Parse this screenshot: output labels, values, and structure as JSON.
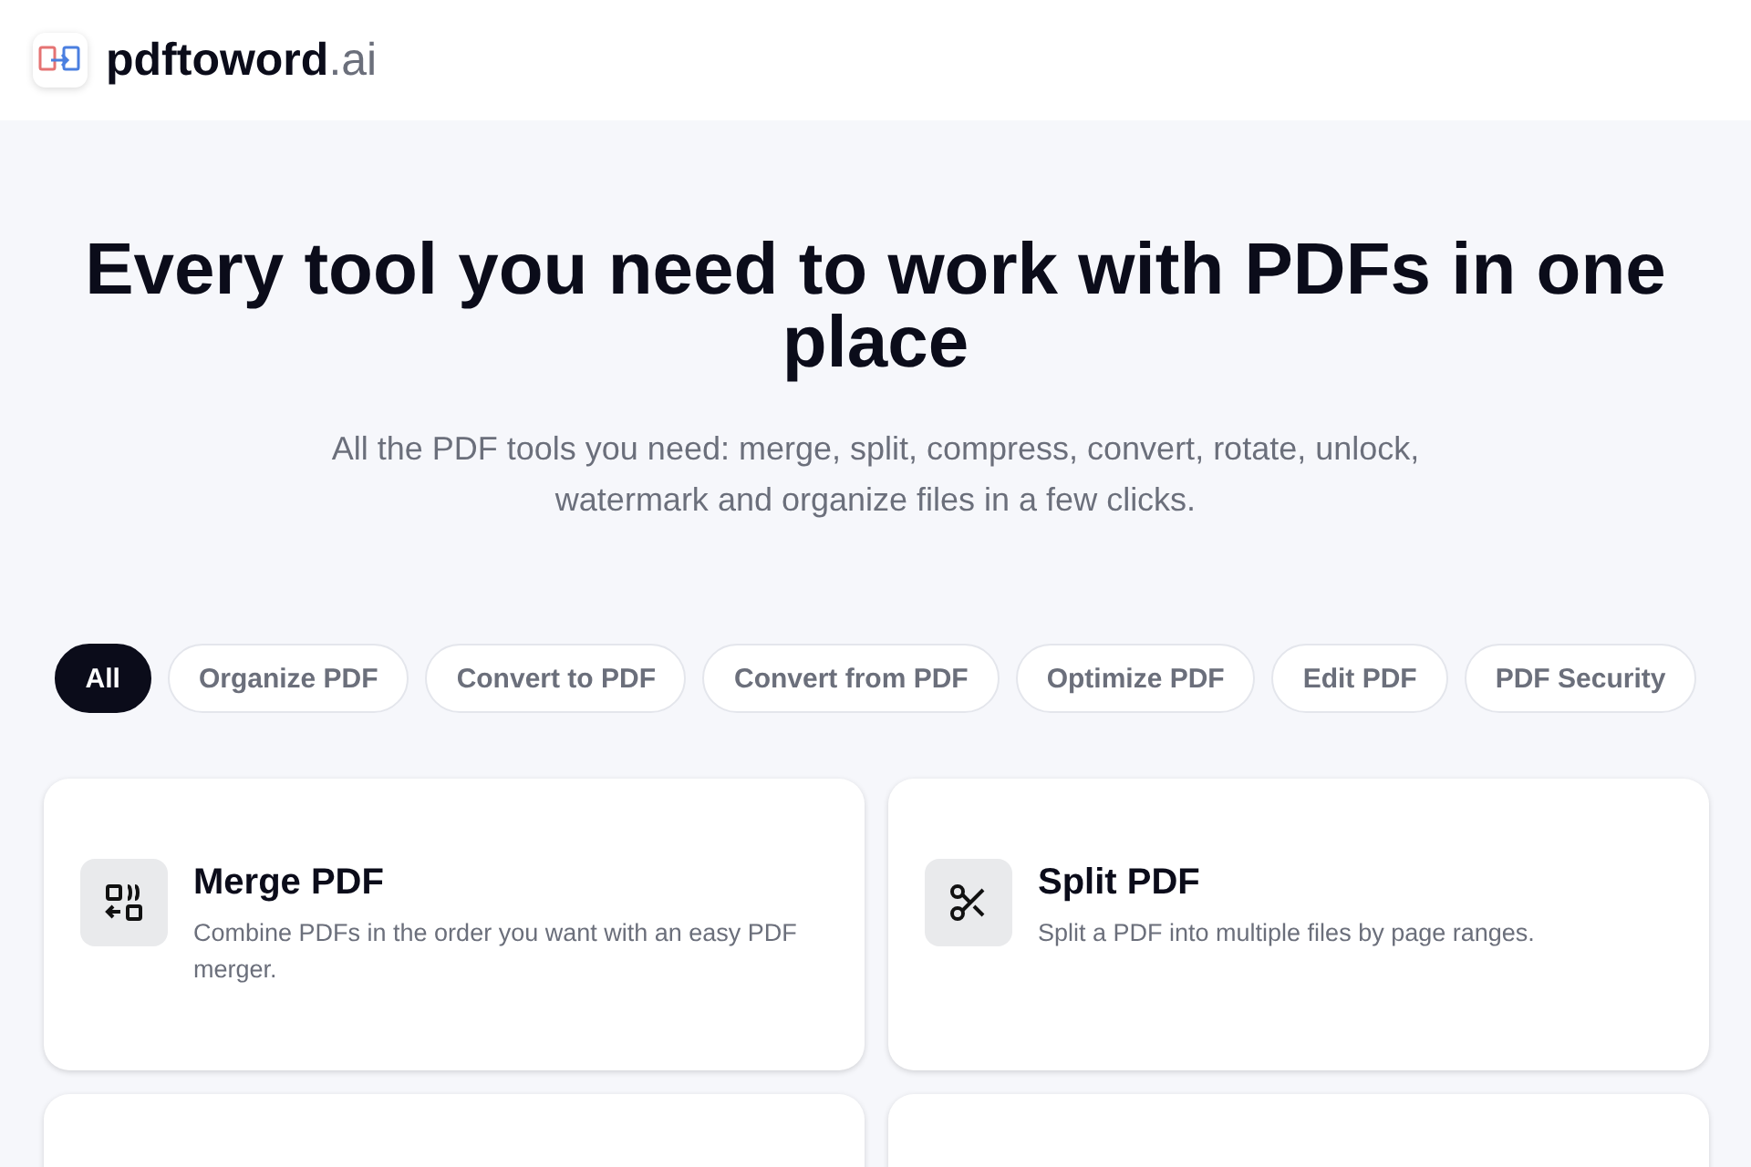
{
  "header": {
    "logo_text": "**pdftoword**.ai"
  },
  "hero": {
    "title": "Every tool you need to work with PDFs in one place",
    "subtitle": "All the PDF tools you need: merge, split, compress, convert, rotate, unlock, watermark and organize files in a few clicks."
  },
  "filters": [
    {
      "label": "All",
      "selected": true
    },
    {
      "label": "Organize PDF",
      "selected": false
    },
    {
      "label": "Convert to PDF",
      "selected": false
    },
    {
      "label": "Convert from PDF",
      "selected": false
    },
    {
      "label": "Optimize PDF",
      "selected": false
    },
    {
      "label": "Edit PDF",
      "selected": false
    },
    {
      "label": "PDF Security",
      "selected": false
    }
  ],
  "tools": [
    {
      "kind": "merge",
      "title": "Merge PDF",
      "description": "Combine PDFs in the order you want with an easy PDF merger."
    },
    {
      "kind": "split",
      "title": "Split PDF",
      "description": "Split a PDF into multiple files by page ranges."
    },
    {
      "kind": "blank"
    },
    {
      "kind": "blank"
    }
  ]
}
